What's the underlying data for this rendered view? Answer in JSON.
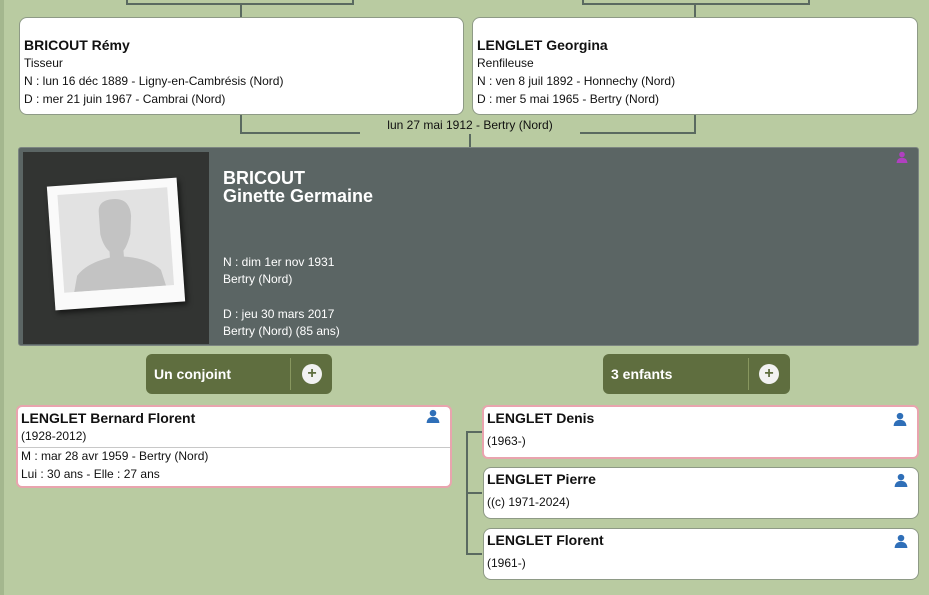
{
  "parents": [
    {
      "name": "BRICOUT Rémy",
      "occupation": "Tisseur",
      "birth": "N : lun 16 déc 1889 - Ligny-en-Cambrésis (Nord)",
      "death": "D : mer 21 juin 1967 - Cambrai (Nord)"
    },
    {
      "name": "LENGLET Georgina",
      "occupation": "Renfileuse",
      "birth": "N : ven 8 juil 1892 - Honnechy (Nord)",
      "death": "D : mer 5 mai 1965 - Bertry (Nord)"
    }
  ],
  "parents_marriage": "lun 27 mai 1912 - Bertry (Nord)",
  "person": {
    "surname": "BRICOUT",
    "given_names": "Ginette Germaine",
    "birth_date": "N : dim 1er nov 1931",
    "birth_place": "Bertry (Nord)",
    "death_date": "D : jeu 30 mars 2017",
    "death_place": "Bertry (Nord) (85 ans)",
    "icon": "person-female-icon",
    "icon_color": "#b040c0"
  },
  "spouse_button": {
    "label": "Un conjoint",
    "plus": "+"
  },
  "children_button": {
    "label": "3 enfants",
    "plus": "+"
  },
  "spouse": {
    "name": "LENGLET Bernard Florent",
    "years": "(1928-2012)",
    "marriage": "M : mar 28 avr 1959 - Bertry (Nord)",
    "ages": "Lui : 30 ans - Elle : 27 ans",
    "icon": "person-male-icon"
  },
  "children": [
    {
      "name": "LENGLET Denis",
      "years": "(1963-)",
      "icon": "person-male-icon"
    },
    {
      "name": "LENGLET Pierre",
      "years": "((c) 1971-2024)",
      "icon": "person-male-icon"
    },
    {
      "name": "LENGLET Florent",
      "years": "(1961-)",
      "icon": "person-male-icon"
    }
  ],
  "colors": {
    "background": "#b9cba1",
    "main_panel": "#5b6564",
    "button": "#5f6e3f",
    "highlight_border": "#e9a4ae",
    "male_icon": "#2f6fb8"
  }
}
